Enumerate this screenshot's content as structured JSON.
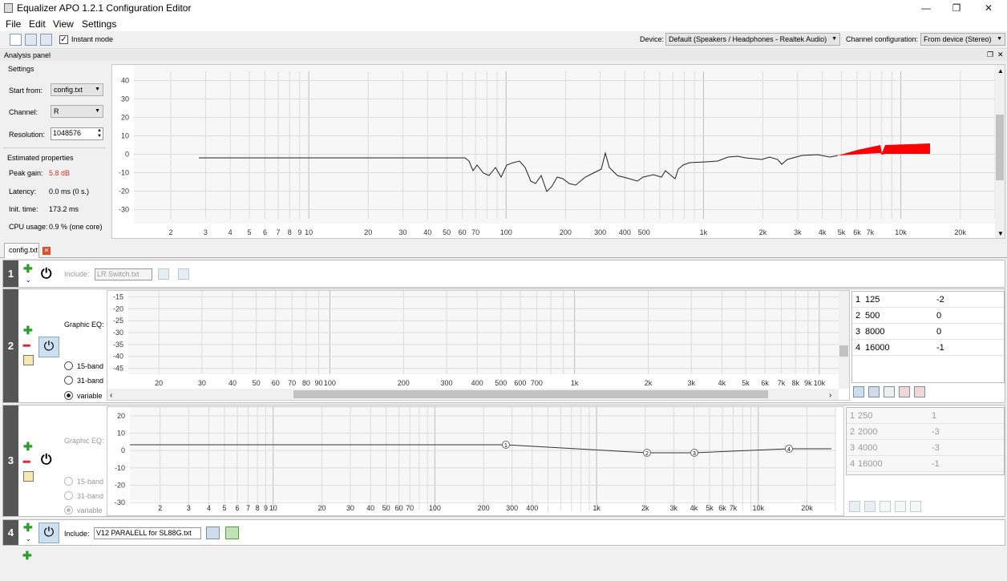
{
  "window": {
    "title": "Equalizer APO 1.2.1 Configuration Editor",
    "min": "—",
    "max": "❐",
    "close": "✕"
  },
  "menu": [
    "File",
    "Edit",
    "View",
    "Settings"
  ],
  "toolbar": {
    "instant_mode": "Instant mode",
    "device_label": "Device:",
    "device_value": "Default (Speakers / Headphones - Realtek Audio)",
    "channel_cfg_label": "Channel configuration:",
    "channel_cfg_value": "From device (Stereo)"
  },
  "analysis": {
    "header": "Analysis panel",
    "settings_title": "Settings",
    "start_from_label": "Start from:",
    "start_from_value": "config.txt",
    "channel_label": "Channel:",
    "channel_value": "R",
    "resolution_label": "Resolution:",
    "resolution_value": "1048576",
    "estimated_title": "Estimated properties",
    "peak_gain_label": "Peak gain:",
    "peak_gain_value": "5.8 dB",
    "latency_label": "Latency:",
    "latency_value": "0.0 ms (0 s.)",
    "init_label": "Init. time:",
    "init_value": "173.2 ms",
    "cpu_label": "CPU usage:",
    "cpu_value": "0.9 % (one core)",
    "y_ticks": [
      "40",
      "30",
      "20",
      "10",
      "0",
      "-10",
      "-20",
      "-30"
    ],
    "x_ticks": [
      "2",
      "3",
      "4",
      "5",
      "6",
      "7",
      "8",
      "9",
      "10",
      "20",
      "30",
      "40",
      "50",
      "60",
      "70",
      "100",
      "200",
      "300",
      "400",
      "500",
      "1k",
      "2k",
      "3k",
      "4k",
      "5k",
      "6k",
      "7k",
      "10k",
      "20k"
    ]
  },
  "tab": {
    "label": "config.txt"
  },
  "rows": {
    "r1": {
      "num": "1",
      "include_label": "Include:",
      "include_value": "LR Switch.txt"
    },
    "r2": {
      "num": "2",
      "label": "Graphic EQ:",
      "radio_15": "15-band",
      "radio_31": "31-band",
      "radio_var": "variable",
      "y_ticks": [
        "-15",
        "-20",
        "-25",
        "-30",
        "-35",
        "-40",
        "-45"
      ],
      "x_ticks": [
        "20",
        "30",
        "40",
        "50",
        "60",
        "70",
        "80",
        "90",
        "100",
        "200",
        "300",
        "400",
        "500",
        "600",
        "700",
        "1k",
        "2k",
        "3k",
        "4k",
        "5k",
        "6k",
        "7k",
        "8k",
        "9k",
        "10k"
      ],
      "bands": [
        {
          "n": "1",
          "f": "125",
          "g": "-2"
        },
        {
          "n": "2",
          "f": "500",
          "g": "0"
        },
        {
          "n": "3",
          "f": "8000",
          "g": "0"
        },
        {
          "n": "4",
          "f": "16000",
          "g": "-1"
        }
      ]
    },
    "r3": {
      "num": "3",
      "label": "Graphic EQ:",
      "radio_15": "15-band",
      "radio_31": "31-band",
      "radio_var": "variable",
      "y_ticks": [
        "20",
        "10",
        "0",
        "-10",
        "-20",
        "-30"
      ],
      "x_ticks": [
        "2",
        "3",
        "4",
        "5",
        "6",
        "7",
        "8",
        "9",
        "10",
        "20",
        "30",
        "40",
        "50",
        "60",
        "70",
        "100",
        "200",
        "300",
        "400",
        "1k",
        "2k",
        "3k",
        "4k",
        "5k",
        "6k",
        "7k",
        "10k",
        "20k"
      ],
      "points": [
        "1",
        "2",
        "3",
        "4"
      ],
      "bands": [
        {
          "n": "1",
          "f": "250",
          "g": "1"
        },
        {
          "n": "2",
          "f": "2000",
          "g": "-3"
        },
        {
          "n": "3",
          "f": "4000",
          "g": "-3"
        },
        {
          "n": "4",
          "f": "16000",
          "g": "-1"
        }
      ]
    },
    "r4": {
      "num": "4",
      "include_label": "Include:",
      "include_value": "V12 PARALELL for SL88G.txt"
    }
  },
  "colors": {
    "accent_red": "#ff0000",
    "peak_text": "#e03030",
    "plus": "#2a9d2a",
    "minus": "#d22233"
  }
}
